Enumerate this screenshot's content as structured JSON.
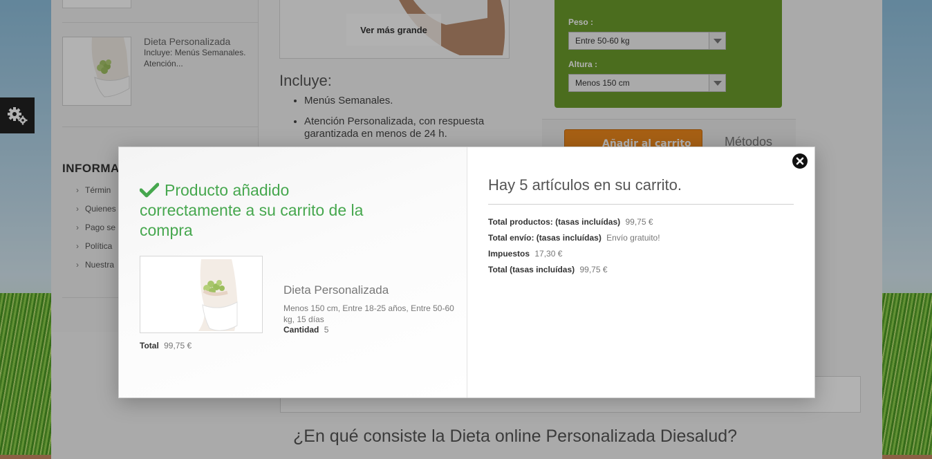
{
  "background": {
    "sidebar": {
      "product_name": "Dieta Personalizada",
      "product_desc": "Incluye: Menús Semanales. Atención...",
      "info_title": "INFORMA",
      "info_items": [
        "Términ",
        "Quienes",
        "Pago se",
        "Política",
        "Nuestra"
      ]
    },
    "main": {
      "view_larger_label": "Ver más grande",
      "includes_title": "Incluye:",
      "includes_items": [
        "Menús Semanales.",
        "Atención Personalizada, con respuesta garantizada en menos de 24 h."
      ],
      "add_to_cart_label": "Añadir al carrito",
      "payment_methods_label": "Métodos",
      "bottom_heading": "¿En qué consiste la Dieta online Personalizada Diesalud?"
    },
    "options": {
      "peso_label": "Peso :",
      "peso_value": "Entre 50-60 kg",
      "altura_label": "Altura :",
      "altura_value": "Menos 150 cm"
    }
  },
  "modal": {
    "success_message": "Producto añadido correctamente a su carrito de la compra",
    "product": {
      "name": "Dieta Personalizada",
      "attributes": "Menos 150 cm, Entre 18-25 años, Entre 50-60 kg, 15 días",
      "quantity_label": "Cantidad",
      "quantity_value": "5",
      "total_label": "Total",
      "total_value": "99,75 €"
    },
    "cart": {
      "count_text": "Hay 5 artículos en su carrito.",
      "products_label": "Total productos: (tasas incluídas)",
      "products_value": "99,75 €",
      "shipping_label": "Total envío: (tasas incluídas)",
      "shipping_value": "Envío gratuito!",
      "tax_label": "Impuestos",
      "tax_value": "17,30 €",
      "total_label": "Total (tasas incluídas)",
      "total_value": "99,75 €"
    }
  },
  "colors": {
    "success_green": "#46a74e",
    "panel_green": "#6c9d2b",
    "cart_button_orange": "#f08a1e"
  }
}
